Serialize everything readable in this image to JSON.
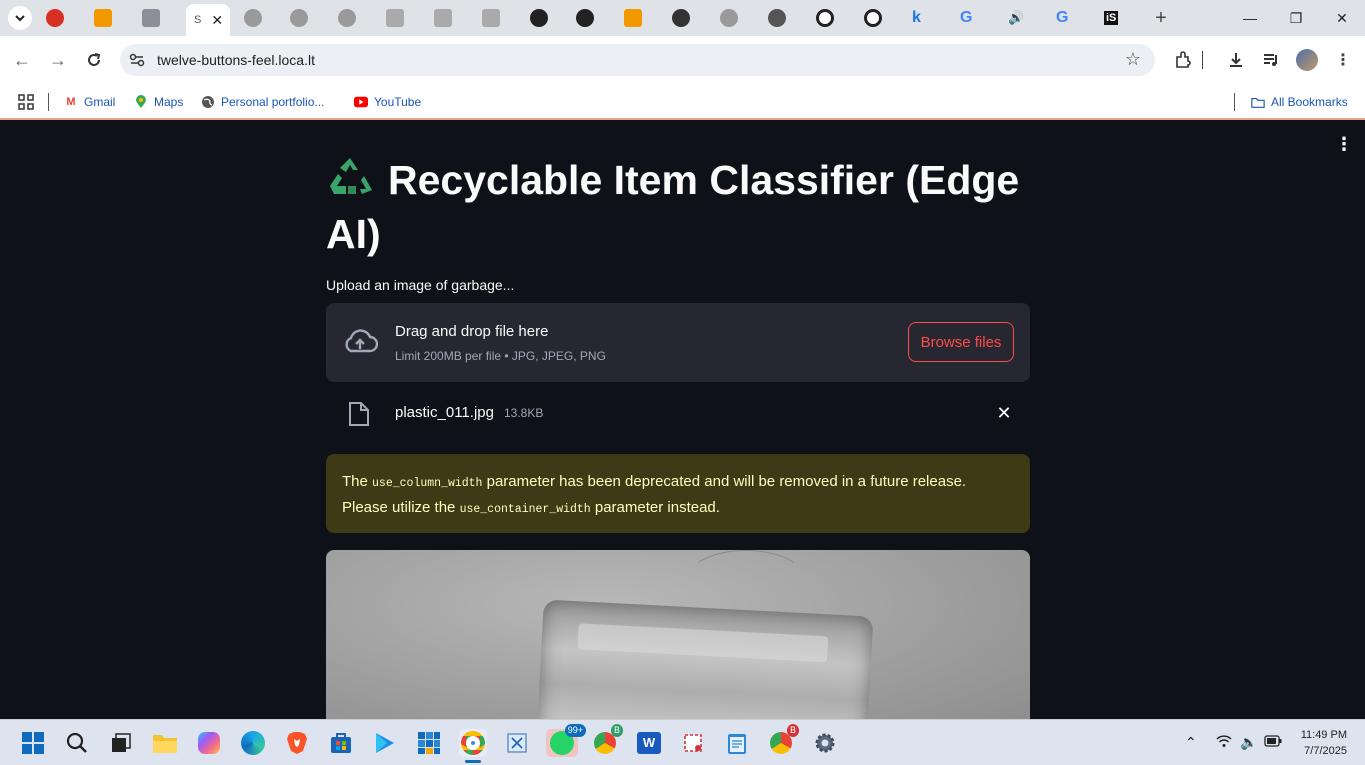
{
  "browser": {
    "url": "twelve-buttons-feel.loca.lt",
    "tabs": [
      {
        "icon": "red-circle-icon",
        "color": "#d93025"
      },
      {
        "icon": "orange-logo-icon",
        "color": "#f29900"
      },
      {
        "icon": "grey-logo-icon",
        "color": "#8a8f98"
      },
      {
        "icon": "streamlit-icon",
        "color": "#ff4b4b",
        "active": true
      },
      {
        "icon": "globe-icon",
        "color": "#777"
      },
      {
        "icon": "globe-icon",
        "color": "#777"
      },
      {
        "icon": "globe-icon",
        "color": "#777"
      },
      {
        "icon": "grey-logo-icon",
        "color": "#888"
      },
      {
        "icon": "grey-logo-icon",
        "color": "#888"
      },
      {
        "icon": "grey-logo-icon",
        "color": "#888"
      },
      {
        "icon": "github-icon",
        "color": "#222"
      },
      {
        "icon": "github-icon",
        "color": "#222"
      },
      {
        "icon": "orange-logo-icon",
        "color": "#f29900"
      },
      {
        "icon": "dark-circle-icon",
        "color": "#333"
      },
      {
        "icon": "globe-icon",
        "color": "#777"
      },
      {
        "icon": "dark-circle-icon",
        "color": "#555"
      },
      {
        "icon": "openai-icon",
        "color": "#222"
      },
      {
        "icon": "openai-icon",
        "color": "#222"
      },
      {
        "icon": "k-logo-icon",
        "color": "#1a73e8"
      },
      {
        "icon": "google-icon",
        "color": "#4285f4"
      },
      {
        "icon": "speaker-icon",
        "color": "#555"
      },
      {
        "icon": "google-icon",
        "color": "#4285f4"
      },
      {
        "icon": "is-logo-icon",
        "color": "#111"
      }
    ],
    "active_tab_text": "S"
  },
  "bookmarks": {
    "items": [
      {
        "label": "Gmail",
        "icon": "gmail-icon"
      },
      {
        "label": "Maps",
        "icon": "maps-icon"
      },
      {
        "label": "Personal portfolio...",
        "icon": "globe-icon"
      },
      {
        "label": "YouTube",
        "icon": "youtube-icon"
      }
    ],
    "all_bookmarks": "All Bookmarks"
  },
  "app": {
    "title": "Recyclable Item Classifier (Edge AI)",
    "title_icon": "recycle-icon",
    "upload_label": "Upload an image of garbage...",
    "dropzone": {
      "title": "Drag and drop file here",
      "limit": "Limit 200MB per file • JPG, JPEG, PNG",
      "browse_label": "Browse files"
    },
    "file": {
      "name": "plastic_011.jpg",
      "size": "13.8KB"
    },
    "alert": {
      "part1": "The",
      "code1": "use_column_width",
      "part2": "parameter has been deprecated and will be removed in a future release. Please utilize the",
      "code2": "use_container_width",
      "part3": "parameter instead."
    },
    "accent_color": "#ff4b4b",
    "warning_bg": "#3d3a15"
  },
  "taskbar": {
    "time": "11:49 PM",
    "date": "7/7/2025",
    "whatsapp_badge": "99+",
    "badge_b1": "B",
    "badge_b2": "B"
  }
}
